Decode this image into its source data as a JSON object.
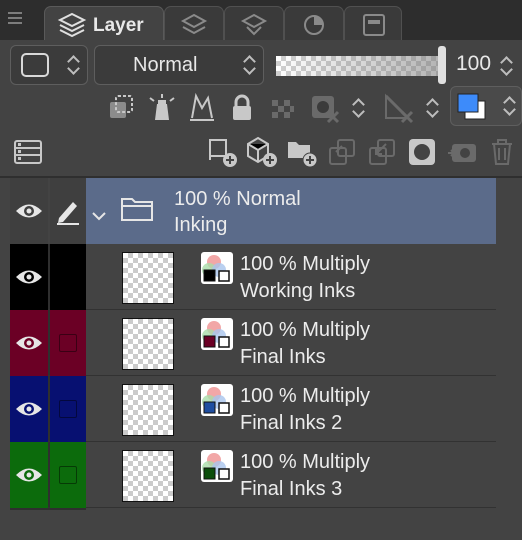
{
  "tabs": [
    {
      "label": "Layer",
      "icon": "layers-icon",
      "active": true
    },
    {
      "icon": "layer-property-icon"
    },
    {
      "icon": "layer-search-icon"
    },
    {
      "icon": "navigator-icon"
    },
    {
      "icon": "material-icon"
    }
  ],
  "controls": {
    "blend_mode": "Normal",
    "opacity_value": "100",
    "opacity_fraction": 1.0,
    "color_swatch": {
      "main": "#3d8bfa",
      "sub": "#ffffff"
    }
  },
  "folder": {
    "title": "100 %  Normal",
    "name": "Inking",
    "color": "#5b6b8a"
  },
  "layers": [
    {
      "title": "100 %  Multiply",
      "name": "Working Inks",
      "color": "#000000",
      "swatch": "#000000"
    },
    {
      "title": "100 %  Multiply",
      "name": "Final Inks",
      "color": "#6b0025",
      "swatch": "#6b0025"
    },
    {
      "title": "100 %  Multiply",
      "name": "Final Inks 2",
      "color": "#071071",
      "swatch": "#1f4ea0"
    },
    {
      "title": "100 %  Multiply",
      "name": "Final Inks 3",
      "color": "#0c6b0c",
      "swatch": "#0c4d0c"
    }
  ],
  "icons": {
    "palette_menu": "palette-menu-icon",
    "expression_color": "expression-color-icon",
    "clip": "clip-lower-layer-icon",
    "reference": "reference-layer-icon",
    "draft": "draft-layer-icon",
    "lock": "lock-layer-icon",
    "lock_transparency": "lock-transparency-icon",
    "mask_enable": "mask-enable-icon",
    "ruler_show": "ruler-show-icon",
    "new_raster": "new-raster-layer-icon",
    "new_vector": "new-vector-layer-icon",
    "new_folder": "new-folder-icon",
    "transfer_down": "transfer-to-lower-icon",
    "merge_down": "merge-down-icon",
    "create_mask": "create-mask-icon",
    "apply_mask": "apply-mask-icon",
    "delete": "delete-layer-icon"
  }
}
